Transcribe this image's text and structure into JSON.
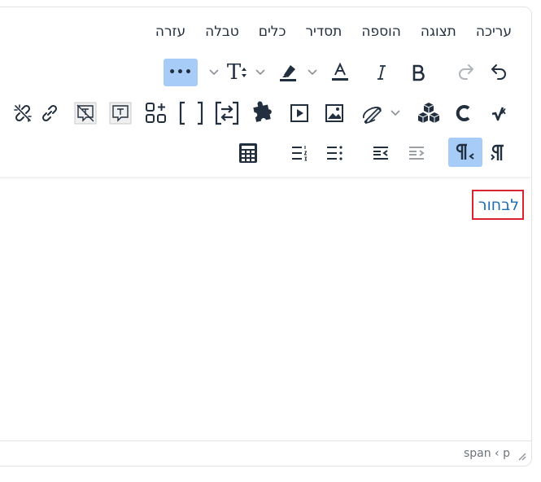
{
  "menubar": {
    "items": [
      "עריכה",
      "תצוגה",
      "הוספה",
      "תסדיר",
      "כלים",
      "טבלה",
      "עזרה"
    ]
  },
  "toolbar": {
    "font_size_label": "T",
    "more_label": "•••"
  },
  "content": {
    "selected_word": "לבחור"
  },
  "statusbar": {
    "element_path": [
      "span",
      "‹",
      "p"
    ]
  },
  "colors": {
    "active_button": "#a6ccf7",
    "link_text": "#1e6fb5",
    "highlight_border": "#d9232e"
  }
}
